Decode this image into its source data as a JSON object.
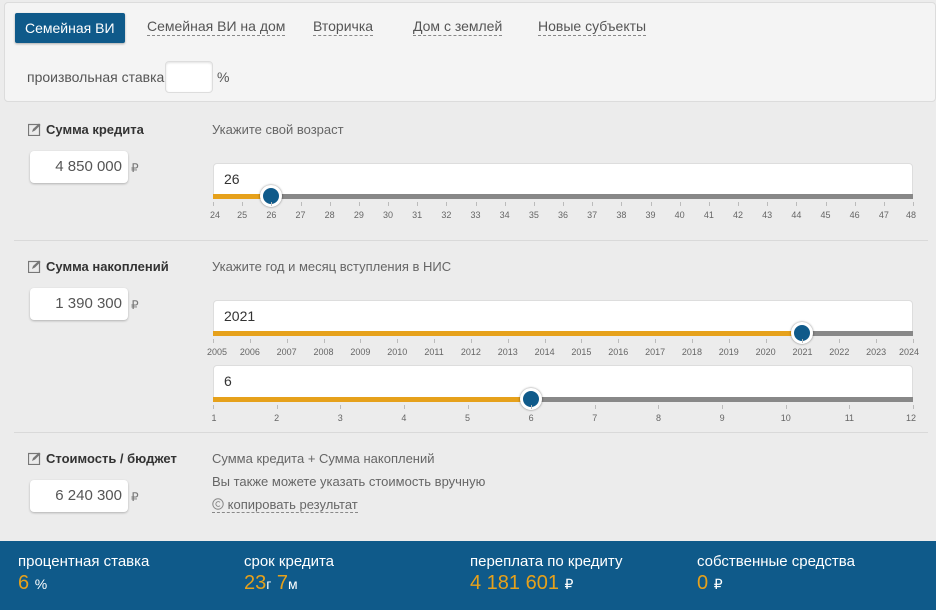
{
  "tabs": [
    {
      "label": "Семейная ВИ",
      "active": true
    },
    {
      "label": "Семейная ВИ на дом"
    },
    {
      "label": "Вторичка"
    },
    {
      "label": "Дом с землей"
    },
    {
      "label": "Новые субъекты"
    }
  ],
  "rate": {
    "label": "произвольная ставка",
    "value": "",
    "unit": "%"
  },
  "credit": {
    "title": "Сумма кредита",
    "amount": "4 850 000",
    "currency": "₽",
    "hint": "Укажите свой возраст",
    "age": {
      "value": "26",
      "min": 24,
      "max": 48,
      "current": 26,
      "ticks": [
        "24",
        "25",
        "26",
        "27",
        "28",
        "29",
        "30",
        "31",
        "32",
        "33",
        "34",
        "35",
        "36",
        "37",
        "38",
        "39",
        "40",
        "41",
        "42",
        "43",
        "44",
        "45",
        "46",
        "47",
        "48"
      ]
    }
  },
  "savings": {
    "title": "Сумма накоплений",
    "amount": "1 390 300",
    "currency": "₽",
    "hint": "Укажите год и месяц вступления в НИС",
    "year": {
      "value": "2021",
      "min": 2005,
      "max": 2024,
      "current": 2021,
      "ticks": [
        "2005",
        "2006",
        "2007",
        "2008",
        "2009",
        "2010",
        "2011",
        "2012",
        "2013",
        "2014",
        "2015",
        "2016",
        "2017",
        "2018",
        "2019",
        "2020",
        "2021",
        "2022",
        "2023",
        "2024"
      ]
    },
    "month": {
      "value": "6",
      "min": 1,
      "max": 12,
      "current": 6,
      "ticks": [
        "1",
        "2",
        "3",
        "4",
        "5",
        "6",
        "7",
        "8",
        "9",
        "10",
        "11",
        "12"
      ]
    }
  },
  "budget": {
    "title": "Стоимость / бюджет",
    "amount": "6 240 300",
    "currency": "₽",
    "hint1": "Сумма кредита + Сумма накоплений",
    "hint2": "Вы также можете указать стоимость вручную",
    "copy_link": "копировать результат"
  },
  "footer": {
    "rate_label": "процентная ставка",
    "rate_value": "6",
    "rate_unit": "%",
    "term_label": "срок кредита",
    "term_years": "23",
    "term_y_unit": "г",
    "term_months": "7",
    "term_m_unit": "м",
    "overpay_label": "переплата по кредиту",
    "overpay_value": "4 181 601",
    "overpay_unit": "₽",
    "own_label": "собственные средства",
    "own_value": "0",
    "own_unit": "₽"
  },
  "colors": {
    "accent": "#e6a11b",
    "brand": "#0f5a8a"
  }
}
